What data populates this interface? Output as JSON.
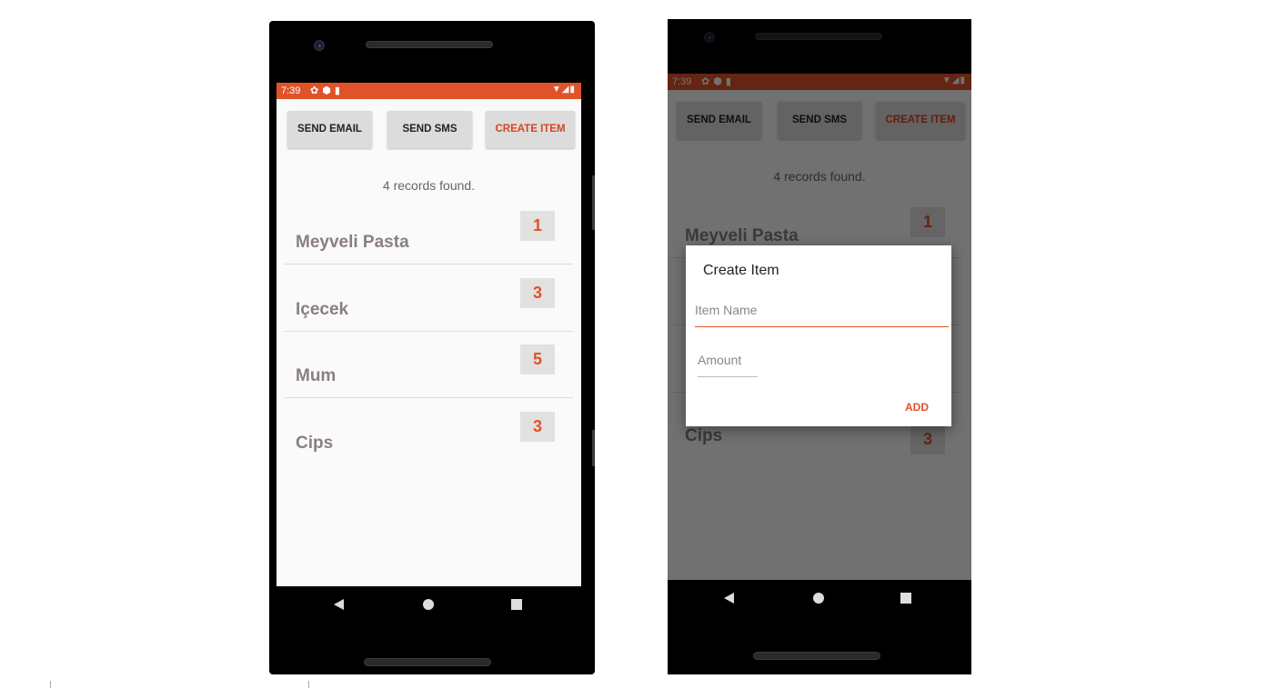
{
  "status": {
    "time": "7:39"
  },
  "toolbar": {
    "send_email": "SEND EMAIL",
    "send_sms": "SEND SMS",
    "create_item": "CREATE ITEM"
  },
  "records_text": "4 records found.",
  "items": [
    {
      "name": "Meyveli Pasta",
      "amount": "1"
    },
    {
      "name": "Içecek",
      "amount": "3"
    },
    {
      "name": "Mum",
      "amount": "5"
    },
    {
      "name": "Cips",
      "amount": "3"
    }
  ],
  "dialog": {
    "title": "Create Item",
    "item_name_placeholder": "Item Name",
    "amount_placeholder": "Amount",
    "add_label": "ADD"
  },
  "colors": {
    "accent": "#e0522a",
    "background": "#fafafa",
    "button": "#dcdcdc"
  },
  "icons": {
    "status_left": [
      "settings-icon",
      "shield-icon",
      "sd-card-icon"
    ],
    "status_right": [
      "wifi-icon",
      "signal-icon",
      "battery-icon"
    ]
  }
}
